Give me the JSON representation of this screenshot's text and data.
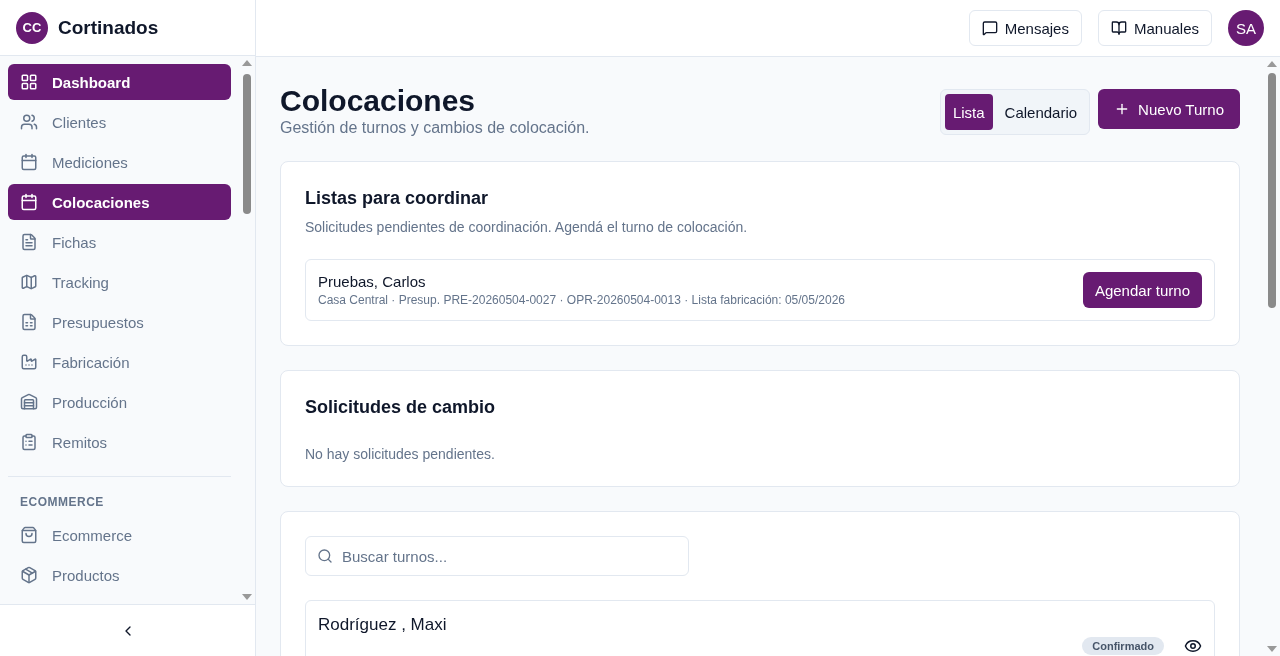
{
  "brand": {
    "initials": "CC",
    "name": "Cortinados"
  },
  "sidebar": {
    "items": [
      {
        "label": "Dashboard",
        "selected": true
      },
      {
        "label": "Clientes",
        "selected": false
      },
      {
        "label": "Mediciones",
        "selected": false
      },
      {
        "label": "Colocaciones",
        "selected": true
      },
      {
        "label": "Fichas",
        "selected": false
      },
      {
        "label": "Tracking",
        "selected": false
      },
      {
        "label": "Presupuestos",
        "selected": false
      },
      {
        "label": "Fabricación",
        "selected": false
      },
      {
        "label": "Producción",
        "selected": false
      },
      {
        "label": "Remitos",
        "selected": false
      }
    ],
    "section": {
      "title": "ECOMMERCE",
      "items": [
        {
          "label": "Ecommerce",
          "selected": false
        },
        {
          "label": "Productos",
          "selected": false
        }
      ]
    }
  },
  "header": {
    "buttons": [
      "Mensajes",
      "Manuales"
    ],
    "avatar": "SA"
  },
  "page": {
    "title": "Colocaciones",
    "subtitle": "Gestión de turnos y cambios de colocación.",
    "view_tabs": [
      {
        "label": "Lista",
        "selected": true
      },
      {
        "label": "Calendario",
        "selected": false
      }
    ],
    "new_button": "Nuevo Turno"
  },
  "coordinate": {
    "title": "Listas para coordinar",
    "description": "Solicitudes pendientes de coordinación. Agendá el turno de colocación.",
    "items": [
      {
        "name": "Pruebas, Carlos",
        "details": "Casa Central · Presup. PRE-20260504-0027 · OPR-20260504-0013 · Lista fabricación: 05/05/2026",
        "action": "Agendar turno"
      }
    ]
  },
  "changes": {
    "title": "Solicitudes de cambio",
    "empty": "No hay solicitudes pendientes."
  },
  "appointments": {
    "search": {
      "placeholder": "Buscar turnos..."
    },
    "rows": [
      {
        "name": "Rodríguez , Maxi",
        "status": "Confirmado"
      }
    ]
  }
}
